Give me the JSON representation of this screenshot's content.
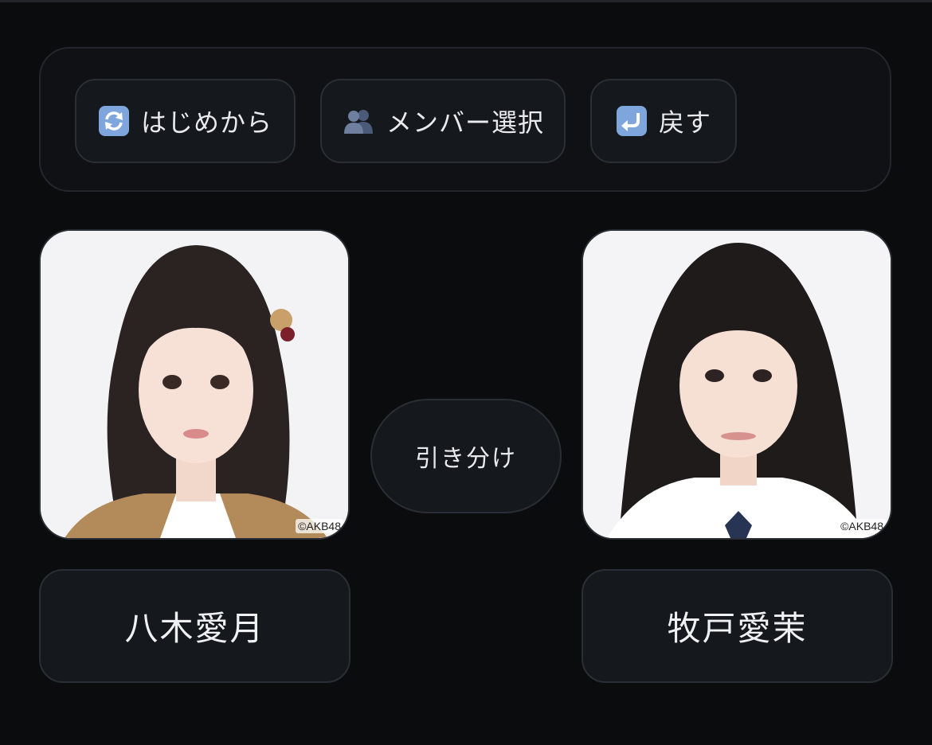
{
  "toolbar": {
    "restart_label": "はじめから",
    "restart_icon": "refresh-icon",
    "members_label": "メンバー選択",
    "members_icon": "people-icon",
    "undo_label": "戻す",
    "undo_icon": "return-arrow-icon"
  },
  "left_member": {
    "name": "八木愛月",
    "photo_credit": "©AKB48"
  },
  "right_member": {
    "name": "牧戸愛茉",
    "photo_credit": "©AKB48"
  },
  "draw_button_label": "引き分け",
  "colors": {
    "background": "#0b0c0e",
    "panel": "#15181c",
    "border": "#2a2e35",
    "text": "#e8eaed",
    "icon_blue": "#5f8fd6"
  }
}
